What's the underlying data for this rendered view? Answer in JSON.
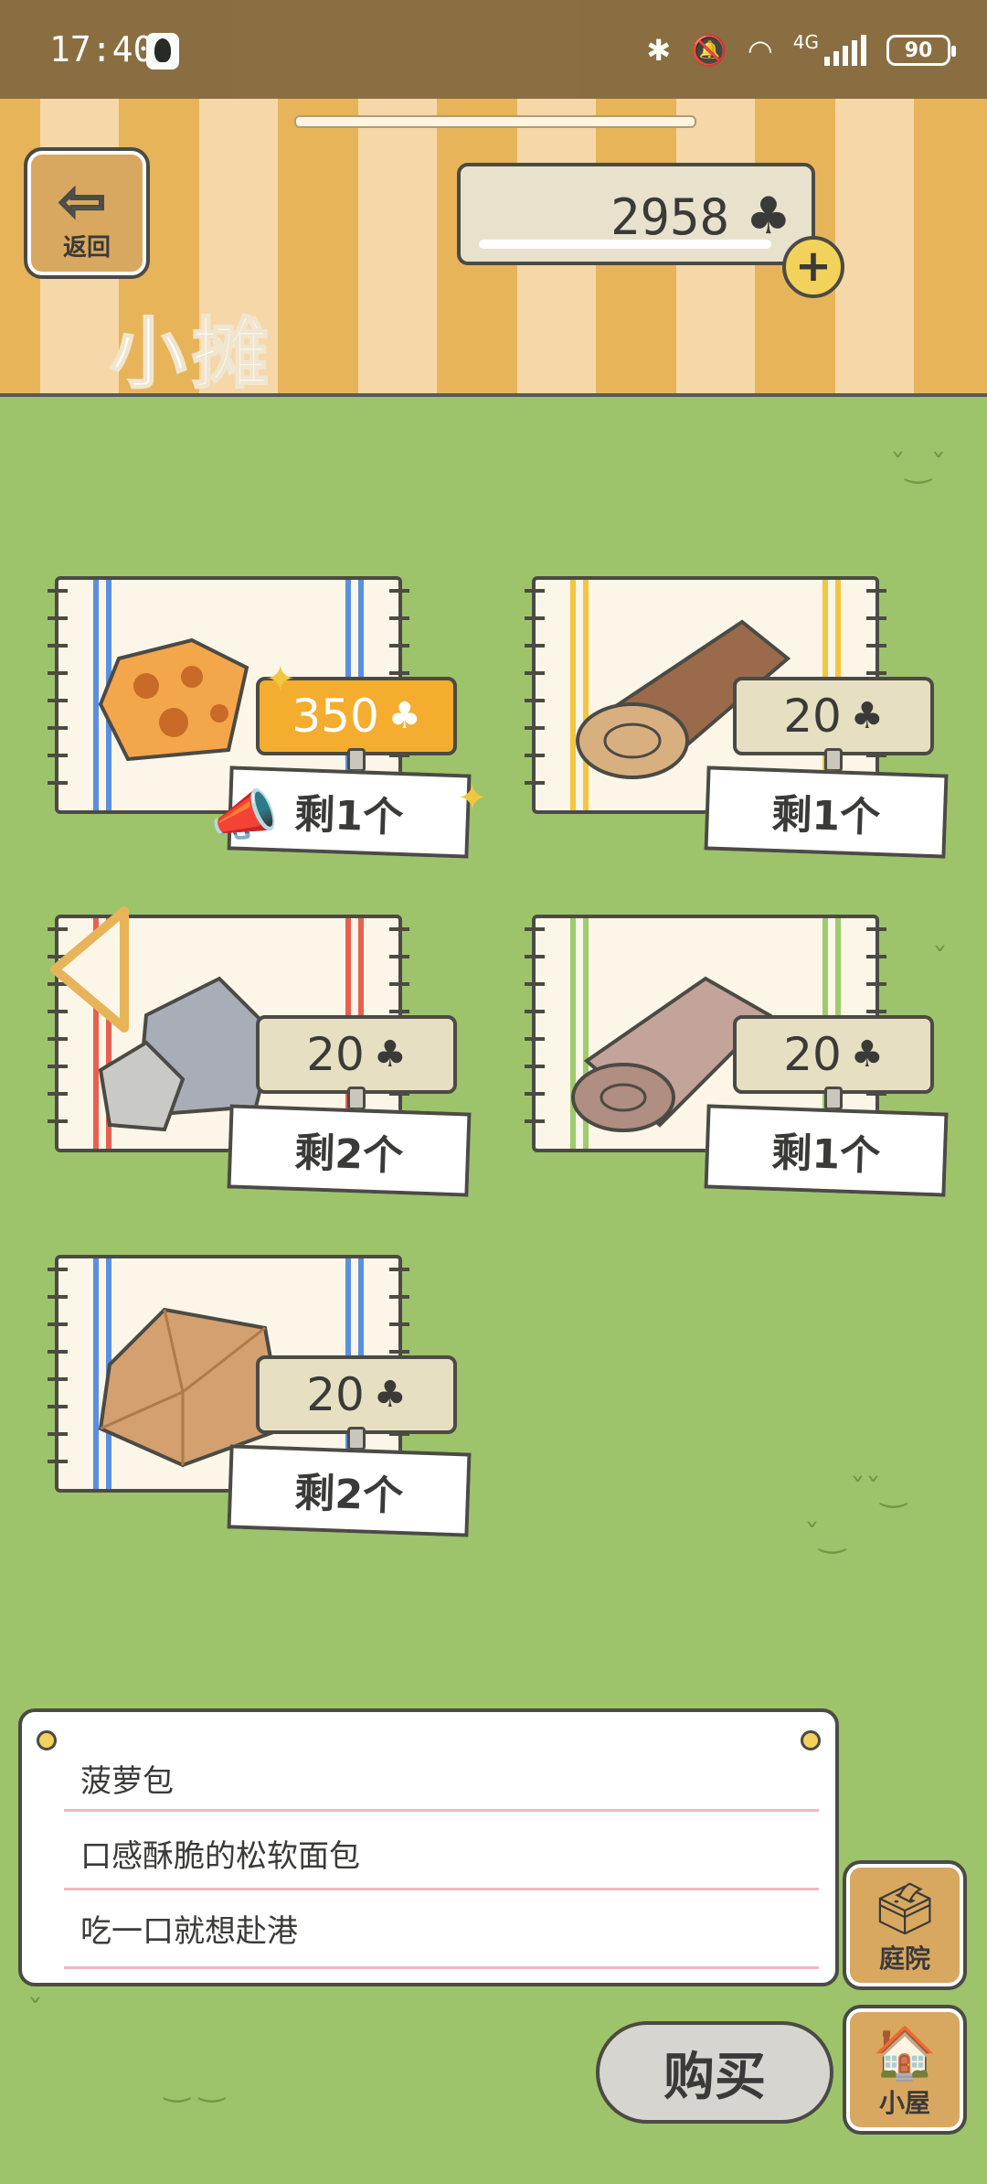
{
  "status_bar": {
    "time": "17:40",
    "battery": "90",
    "network": "4G"
  },
  "header": {
    "back_label": "返回",
    "title": "小摊",
    "clover_count": "2958"
  },
  "items": [
    {
      "name": "菠萝包",
      "price": "350",
      "stock": "剩1个",
      "rug_stripe": "#5b8fe0",
      "highlighted": true
    },
    {
      "name": "木头",
      "price": "20",
      "stock": "剩1个",
      "rug_stripe": "#f2c640",
      "highlighted": false
    },
    {
      "name": "石头",
      "price": "20",
      "stock": "剩2个",
      "rug_stripe": "#e86050",
      "highlighted": false
    },
    {
      "name": "布料",
      "price": "20",
      "stock": "剩1个",
      "rug_stripe": "#9dcc6a",
      "highlighted": false
    },
    {
      "name": "纸袋",
      "price": "20",
      "stock": "剩2个",
      "rug_stripe": "#5b8fe0",
      "highlighted": false
    }
  ],
  "description": {
    "line1": "菠萝包",
    "line2": "口感酥脆的松软面包",
    "line3": "吃一口就想赴港"
  },
  "side_buttons": {
    "yard": "庭院",
    "house": "小屋"
  },
  "buy_label": "购买",
  "colors": {
    "grass": "#9dc46a",
    "header_stripe": "#e8b45a",
    "price_hot": "#f4ad2e"
  }
}
